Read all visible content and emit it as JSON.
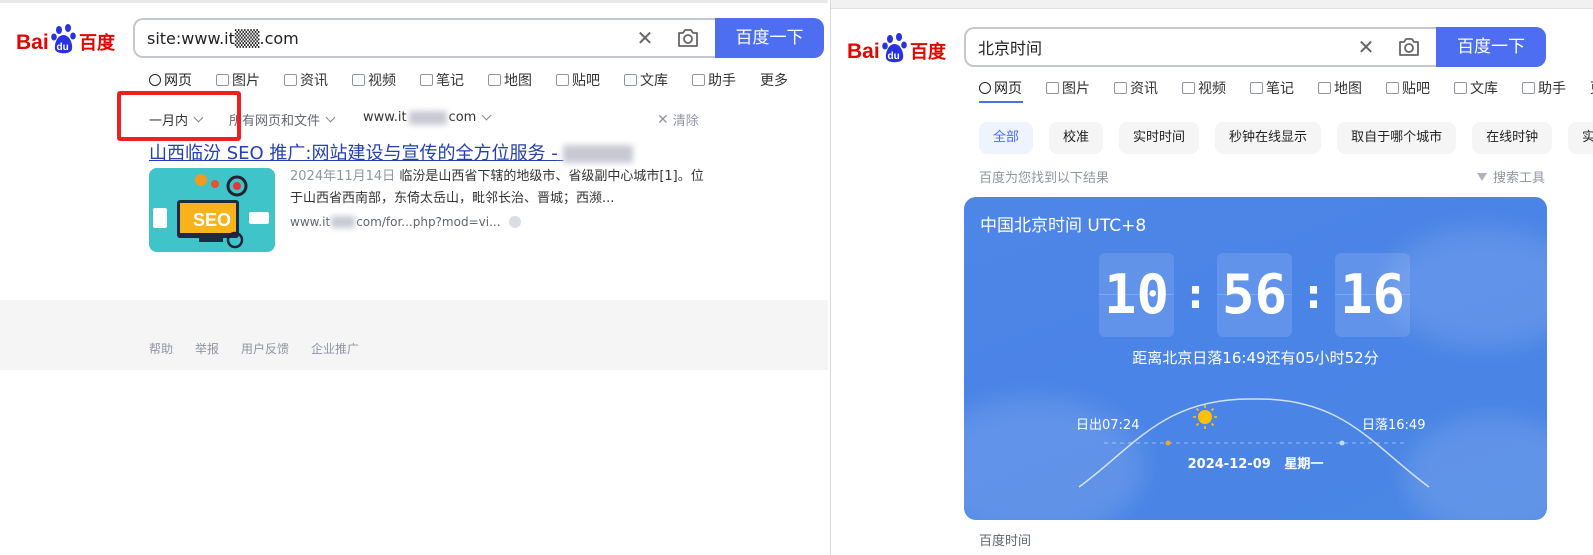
{
  "left": {
    "logo": {
      "bai": "Bai",
      "du": "du",
      "cn": "百度"
    },
    "search": {
      "value": "site:www.it▒▒.com",
      "clear": "✕",
      "button": "百度一下"
    },
    "tabs": [
      {
        "label": "网页",
        "icon": "search-icon"
      },
      {
        "label": "图片",
        "icon": "image-icon"
      },
      {
        "label": "资讯",
        "icon": "news-icon"
      },
      {
        "label": "视频",
        "icon": "video-icon"
      },
      {
        "label": "笔记",
        "icon": "note-icon"
      },
      {
        "label": "地图",
        "icon": "map-icon"
      },
      {
        "label": "贴吧",
        "icon": "tieba-icon"
      },
      {
        "label": "文库",
        "icon": "doc-icon"
      },
      {
        "label": "助手",
        "icon": "ai-icon"
      },
      {
        "label": "更多",
        "icon": ""
      }
    ],
    "filters": {
      "time": "一月内",
      "type": "所有网页和文件",
      "site_prefix": "www.it",
      "site_suffix": "com",
      "clear": "清除"
    },
    "result": {
      "title": "山西临汾 SEO 推广:网站建设与宣传的全方位服务 -",
      "date": "2024年11月14日",
      "snippet": "临汾是山西省下辖的地级市、省级副中心城市[1]。位于山西省西南部，东倚太岳山，毗邻长治、晋城；西濒...",
      "url_prefix": "www.it",
      "url_suffix": "com/for...php?mod=vi..."
    },
    "footer": [
      "帮助",
      "举报",
      "用户反馈",
      "企业推广"
    ]
  },
  "right": {
    "logo": {
      "bai": "Bai",
      "du": "du",
      "cn": "百度"
    },
    "search": {
      "value": "北京时间",
      "clear": "✕",
      "button": "百度一下"
    },
    "tabs": [
      {
        "label": "网页",
        "icon": "search-icon"
      },
      {
        "label": "图片",
        "icon": "image-icon"
      },
      {
        "label": "资讯",
        "icon": "news-icon"
      },
      {
        "label": "视频",
        "icon": "video-icon"
      },
      {
        "label": "笔记",
        "icon": "note-icon"
      },
      {
        "label": "地图",
        "icon": "map-icon"
      },
      {
        "label": "贴吧",
        "icon": "tieba-icon"
      },
      {
        "label": "文库",
        "icon": "doc-icon"
      },
      {
        "label": "助手",
        "icon": "ai-icon"
      },
      {
        "label": "更多",
        "icon": ""
      }
    ],
    "chips": [
      "全部",
      "校准",
      "实时时间",
      "秒钟在线显示",
      "取自于哪个城市",
      "在线时钟",
      "实时"
    ],
    "result_count": "百度为您找到以下结果",
    "tools": "搜索工具",
    "clock": {
      "title": "中国北京时间 UTC+8",
      "hh": "10",
      "mm": "56",
      "ss": "16",
      "sunset_msg": "距离北京日落16:49还有05小时52分",
      "sunrise": "日出07:24",
      "sunset": "日落16:49",
      "date": "2024-12-09   星期一"
    },
    "source": "百度时间"
  },
  "colors": {
    "brand_blue": "#4e6ef2",
    "baidu_red": "#e10601",
    "baidu_blue": "#2932e1",
    "link": "#2440b3",
    "highlight": "#f02020"
  }
}
